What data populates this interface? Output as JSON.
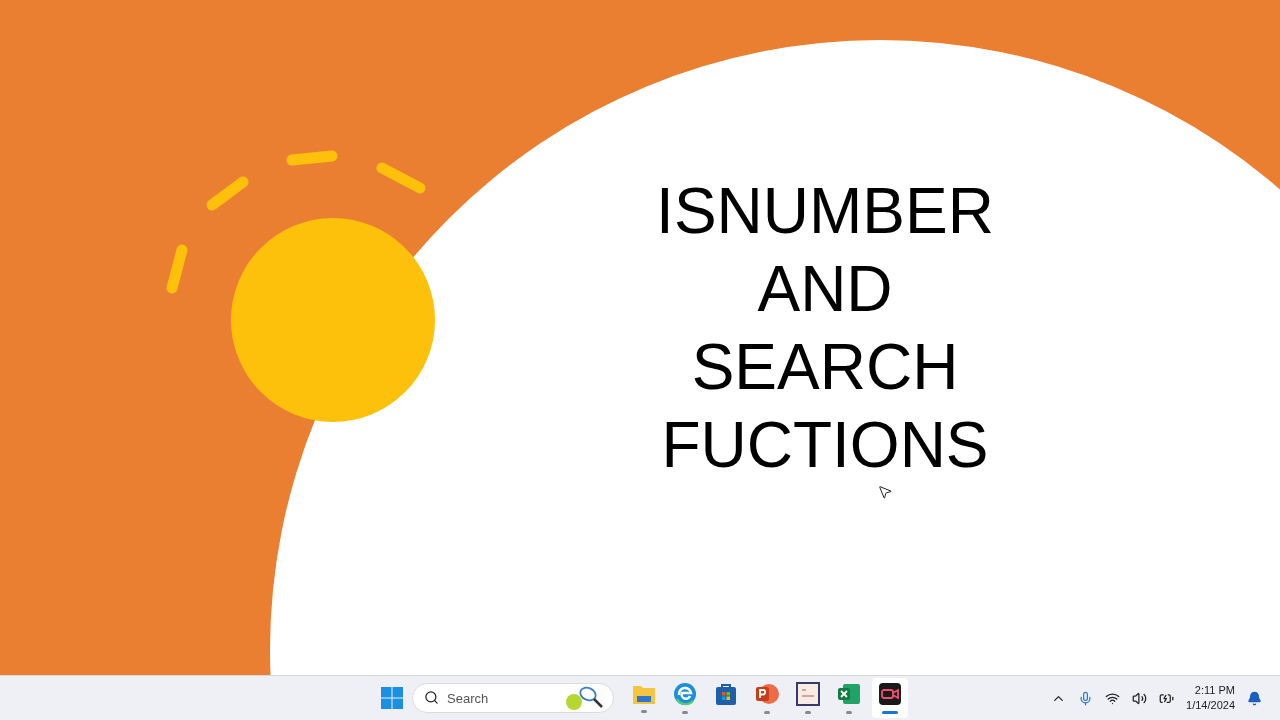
{
  "slide": {
    "title_lines": [
      "ISNUMBER",
      "AND",
      "SEARCH",
      "FUCTIONS"
    ]
  },
  "taskbar": {
    "search": {
      "placeholder": "Search"
    },
    "apps": [
      {
        "kind": "folder",
        "running": true,
        "selected": false
      },
      {
        "kind": "browser",
        "running": true,
        "selected": false
      },
      {
        "kind": "store",
        "running": false,
        "selected": false
      },
      {
        "kind": "slides",
        "running": true,
        "selected": false
      },
      {
        "kind": "tile",
        "running": true,
        "selected": false
      },
      {
        "kind": "sheet",
        "running": true,
        "selected": false
      },
      {
        "kind": "recorder",
        "running": true,
        "selected": true
      }
    ],
    "clock": {
      "time": "2:11 PM",
      "date": "1/14/2024"
    }
  }
}
